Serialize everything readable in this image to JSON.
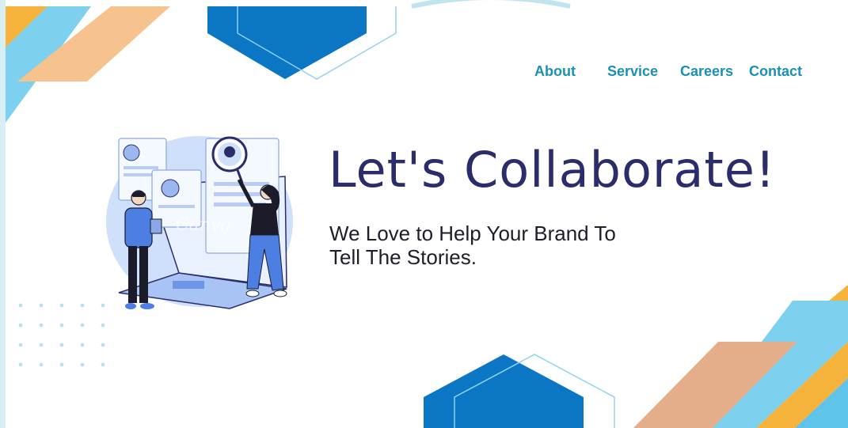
{
  "nav": {
    "items": [
      {
        "label": "About"
      },
      {
        "label": "Service"
      },
      {
        "label": "Careers"
      },
      {
        "label": "Contact"
      }
    ]
  },
  "hero": {
    "title": "Let's Collaborate!",
    "subtitle_line1": "We Love to Help Your Brand To",
    "subtitle_line2": "Tell The Stories."
  },
  "illustration": {
    "watermark": "Canva"
  },
  "colors": {
    "nav_link": "#1a8fb7",
    "title": "#2b2c6a",
    "hex_blue": "#0b76c3",
    "stripe_orange": "#f6c28e",
    "stripe_sky": "#7ed0ef",
    "stripe_tan": "#e5ae8a",
    "stripe_gold": "#f5b33c",
    "dot": "#b9e1ee"
  }
}
